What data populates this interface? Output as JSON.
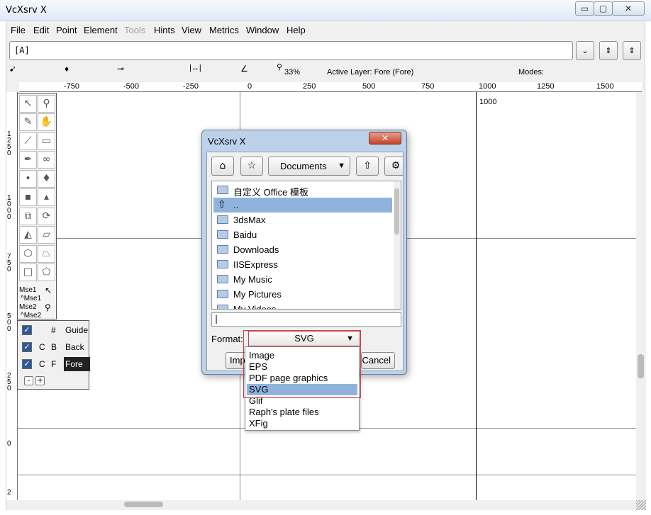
{
  "window": {
    "title": "VcXsrv X",
    "minimize": "▭",
    "maximize": "▢",
    "close": "✕"
  },
  "menu": [
    "File",
    "Edit",
    "Point",
    "Element",
    "Tools",
    "Hints",
    "View",
    "Metrics",
    "Window",
    "Help"
  ],
  "menu_disabled": "Tools",
  "glyph_field": "[A]",
  "glyph_buttons": {
    "dropdown": "⌄",
    "prev": "⇕",
    "next": "⇕"
  },
  "status": {
    "zoom": "33%",
    "active_layer": "Active Layer: Fore (Fore)",
    "modes": "Modes:"
  },
  "ruler_top": [
    "-750",
    "-500",
    "-250",
    "0",
    "250",
    "500",
    "750",
    "1000",
    "1250",
    "1500"
  ],
  "ruler_left": [
    "1250",
    "1000",
    "750",
    "500",
    "250",
    "0",
    "2"
  ],
  "canvas_label": "1000",
  "toolbox": {
    "icons": [
      "pointer-icon",
      "magnify-icon",
      "freehand-icon",
      "scroll-hand-icon",
      "knife-icon",
      "ruler-icon",
      "pen-icon",
      "spiro-icon",
      "curve-point-icon",
      "hv-curve-point-icon",
      "corner-point-icon",
      "tangent-point-icon",
      "scale-icon",
      "rotate-icon",
      "flip-icon",
      "skew-icon",
      "3d-rotate-icon",
      "perspective-icon",
      "rectangle-icon",
      "polygon-icon"
    ],
    "mouse_labels": [
      "Mse1",
      "^Mse1",
      "Mse2",
      "^Mse2"
    ]
  },
  "layers": [
    {
      "flag_a": "",
      "flag_b": "#",
      "name": "Guide"
    },
    {
      "flag_a": "C",
      "flag_b": "B",
      "name": "Back"
    },
    {
      "flag_a": "C",
      "flag_b": "F",
      "name": "Fore"
    }
  ],
  "layer_buttons": {
    "remove": "-",
    "add": "+"
  },
  "dialog": {
    "title": "VcXsrv X",
    "directory": "Documents",
    "files": [
      "自定义 Office 模板",
      "..",
      "3dsMax",
      "Baidu",
      "Downloads",
      "IISExpress",
      "My Music",
      "My Pictures",
      "My Videos"
    ],
    "selected_file": "..",
    "format_label": "Format:",
    "format_value": "SVG",
    "import_button": "Import",
    "cancel_button": "Cancel"
  },
  "format_options": [
    "Image",
    "EPS",
    "PDF page graphics",
    "SVG",
    "Glif",
    "Raph's plate files",
    "XFig"
  ],
  "selected_format": "SVG"
}
